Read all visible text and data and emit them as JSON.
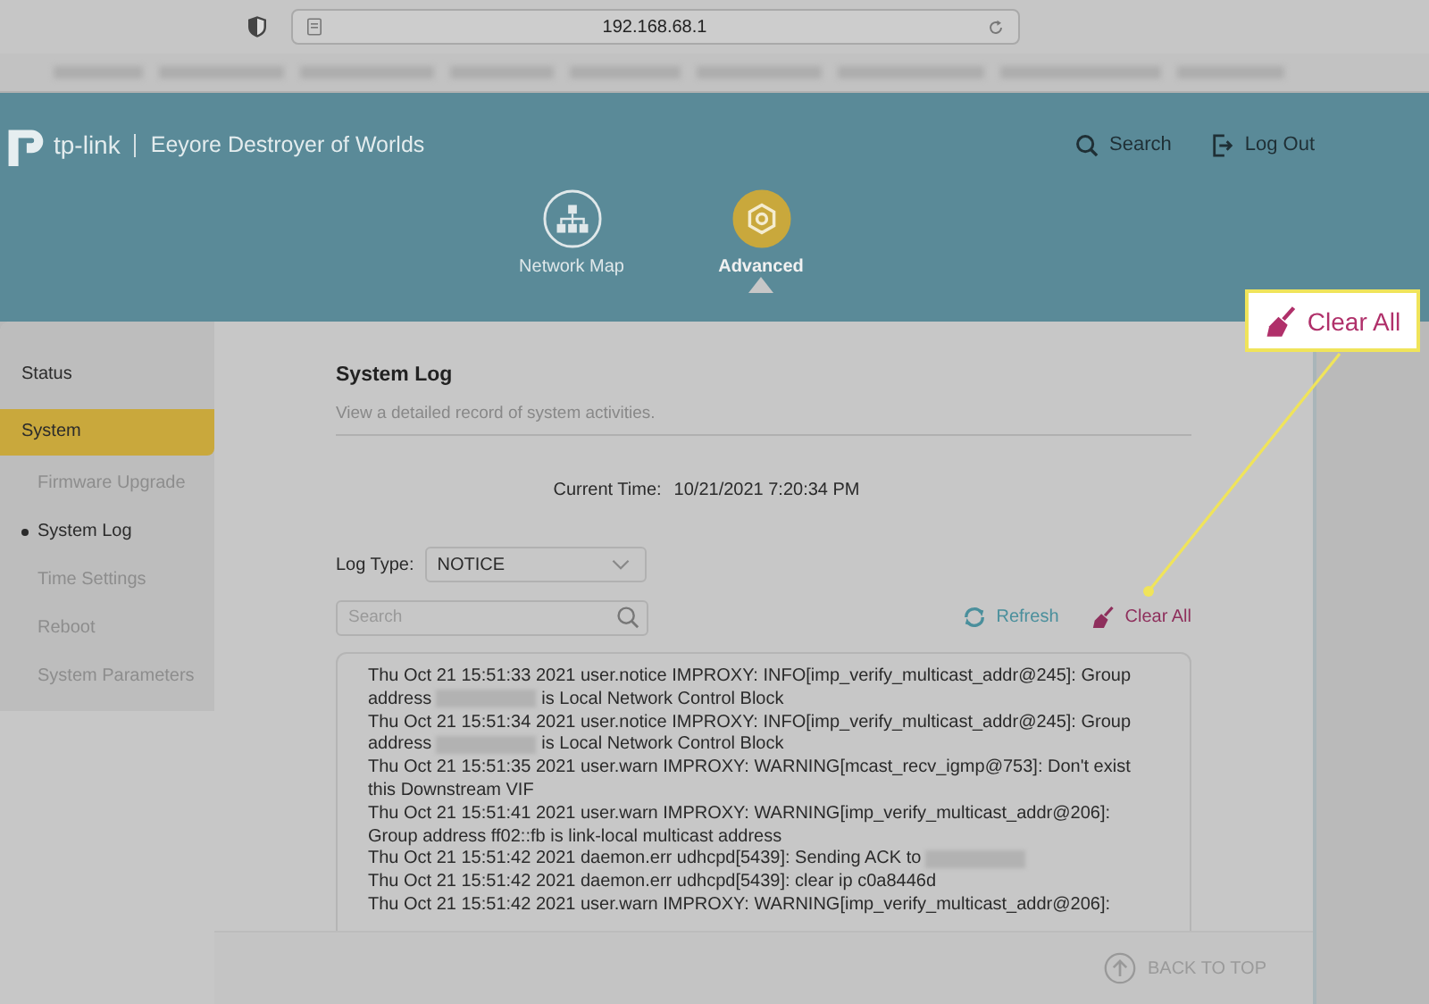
{
  "browser": {
    "url": "192.168.68.1"
  },
  "header": {
    "brand": "tp-link",
    "device_name": "Eeyore Destroyer of Worlds",
    "actions": [
      {
        "label": "Search",
        "kind": "search"
      },
      {
        "label": "Log Out",
        "kind": "logout"
      }
    ]
  },
  "nav_tabs": [
    {
      "label": "Network Map",
      "kind": "map",
      "selected": false
    },
    {
      "label": "Advanced",
      "kind": "gear",
      "selected": true
    }
  ],
  "sidebar": {
    "items": [
      {
        "label": "Status",
        "selected": false
      },
      {
        "label": "System",
        "selected": true,
        "children": [
          {
            "label": "Firmware Upgrade",
            "selected": false
          },
          {
            "label": "System Log",
            "selected": true
          },
          {
            "label": "Time Settings",
            "selected": false
          },
          {
            "label": "Reboot",
            "selected": false
          },
          {
            "label": "System Parameters",
            "selected": false
          }
        ]
      }
    ]
  },
  "page": {
    "title": "System Log",
    "subtitle": "View a detailed record of system activities.",
    "current_time_label": "Current Time:",
    "current_time": "10/21/2021 7:20:34 PM",
    "log_type": {
      "label": "Log Type:",
      "value": "NOTICE"
    },
    "search": {
      "placeholder": "Search"
    },
    "actions": [
      {
        "label": "Refresh",
        "kind": "refresh"
      },
      {
        "label": "Clear All",
        "kind": "clear"
      }
    ],
    "log": [
      [
        {
          "kind": "text",
          "text": "Thu Oct 21 15:51:33 2021 user.notice IMPROXY: INFO[imp_verify_multicast_addr@245]: Group"
        }
      ],
      [
        {
          "kind": "text",
          "text": "address"
        },
        {
          "kind": "redacted"
        },
        {
          "kind": "text",
          "text": "is Local Network Control Block"
        }
      ],
      [
        {
          "kind": "text",
          "text": "Thu Oct 21 15:51:34 2021 user.notice IMPROXY: INFO[imp_verify_multicast_addr@245]: Group"
        }
      ],
      [
        {
          "kind": "text",
          "text": "address"
        },
        {
          "kind": "redacted"
        },
        {
          "kind": "text",
          "text": "is Local Network Control Block"
        }
      ],
      [
        {
          "kind": "text",
          "text": "Thu Oct 21 15:51:35 2021 user.warn IMPROXY: WARNING[mcast_recv_igmp@753]: Don't exist"
        }
      ],
      [
        {
          "kind": "text",
          "text": "this Downstream VIF"
        }
      ],
      [
        {
          "kind": "text",
          "text": "Thu Oct 21 15:51:41 2021 user.warn IMPROXY: WARNING[imp_verify_multicast_addr@206]:"
        }
      ],
      [
        {
          "kind": "text",
          "text": "Group address ff02::fb is link-local multicast address"
        }
      ],
      [
        {
          "kind": "text",
          "text": "Thu Oct 21 15:51:42 2021 daemon.err udhcpd[5439]: Sending ACK to"
        },
        {
          "kind": "redacted"
        }
      ],
      [
        {
          "kind": "text",
          "text": "Thu Oct 21 15:51:42 2021 daemon.err udhcpd[5439]: clear ip c0a8446d"
        }
      ],
      [
        {
          "kind": "text",
          "text": "Thu Oct 21 15:51:42 2021 user.warn IMPROXY: WARNING[imp_verify_multicast_addr@206]:"
        }
      ]
    ],
    "back_to_top": "BACK TO TOP"
  },
  "callout": {
    "label": "Clear All"
  }
}
